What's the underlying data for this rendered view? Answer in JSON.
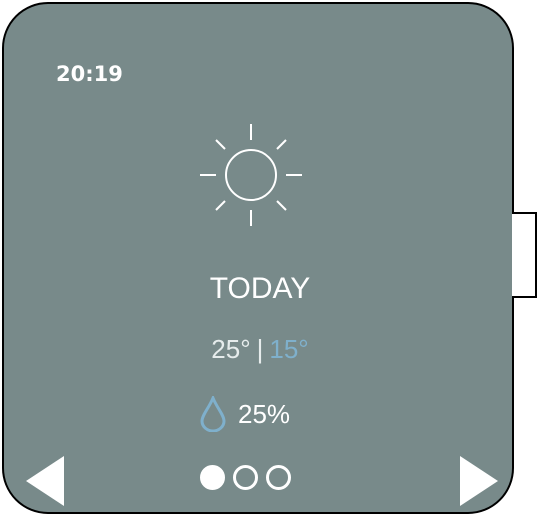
{
  "status": {
    "time": "20:19"
  },
  "weather": {
    "icon": "sun-icon",
    "day_label": "TODAY",
    "high": "25°",
    "separator": "|",
    "low": "15°",
    "precip_icon": "raindrop-icon",
    "precipitation": "25%"
  },
  "pager": {
    "pages": 3,
    "active_index": 0
  },
  "colors": {
    "background": "#788a8a",
    "low_temp": "#7fb0cc",
    "drop": "#7fb0cc"
  }
}
